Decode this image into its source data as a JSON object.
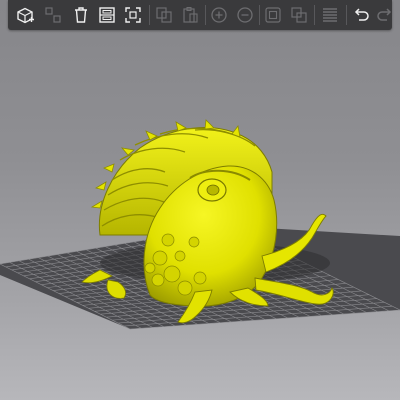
{
  "app": {
    "name": "slicer-3d-view"
  },
  "toolbar": {
    "buttons": [
      {
        "id": "add",
        "icon": "add-cube-icon",
        "enabled": true
      },
      {
        "id": "arrange",
        "icon": "arrange-icon",
        "enabled": false
      },
      {
        "id": "delete",
        "icon": "trash-icon",
        "enabled": true
      },
      {
        "id": "layout",
        "icon": "layout-icon",
        "enabled": true
      },
      {
        "id": "auto-orient",
        "icon": "auto-orient-icon",
        "enabled": true
      },
      {
        "id": "copy",
        "icon": "copy-icon",
        "enabled": false
      },
      {
        "id": "paste",
        "icon": "paste-icon",
        "enabled": false
      },
      {
        "id": "add-instance",
        "icon": "plus-circle-icon",
        "enabled": false
      },
      {
        "id": "remove-instance",
        "icon": "minus-circle-icon",
        "enabled": false
      },
      {
        "id": "split-objects",
        "icon": "split-objects-icon",
        "enabled": false
      },
      {
        "id": "split-parts",
        "icon": "split-parts-icon",
        "enabled": false
      },
      {
        "id": "layers",
        "icon": "layers-icon",
        "enabled": false
      },
      {
        "id": "undo",
        "icon": "undo-icon",
        "enabled": true
      },
      {
        "id": "redo",
        "icon": "redo-icon",
        "enabled": false
      }
    ]
  },
  "scene": {
    "model_color": "#e8e800",
    "model_shade": "#9a9a00",
    "bed_color": "#4a4a4e",
    "grid_color": "#8a8a8e"
  }
}
